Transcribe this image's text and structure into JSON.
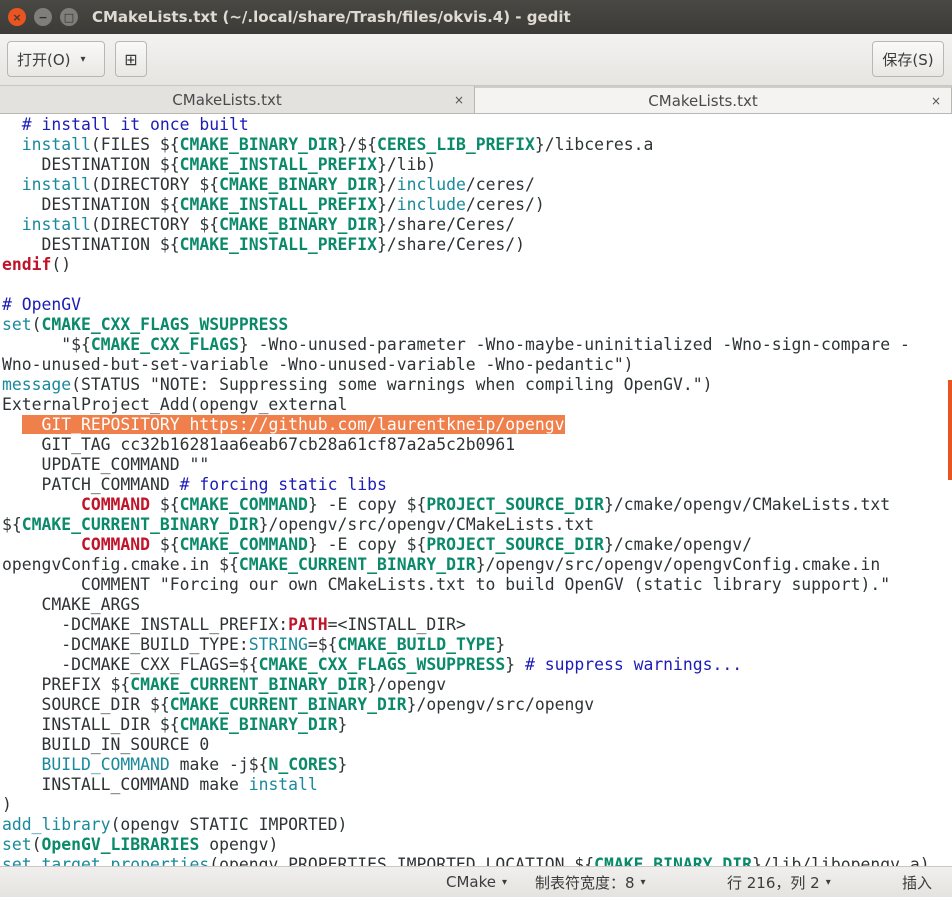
{
  "window": {
    "title": "CMakeLists.txt (~/.local/share/Trash/files/okvis.4) - gedit",
    "close_glyph": "×",
    "min_glyph": "−",
    "max_glyph": "□"
  },
  "toolbar": {
    "open_label": "打开(O)",
    "open_arrow": "▾",
    "new_tab_glyph": "⊞",
    "save_label": "保存(S)"
  },
  "tabs": [
    {
      "label": "CMakeLists.txt",
      "close": "×",
      "active": false
    },
    {
      "label": "CMakeLists.txt",
      "close": "×",
      "active": true
    }
  ],
  "editor": {
    "lines": [
      [
        [
          "  ",
          ""
        ],
        [
          "# install it once built",
          "c"
        ]
      ],
      [
        [
          "  ",
          ""
        ],
        [
          "install",
          "k"
        ],
        [
          "(FILES ${",
          ""
        ],
        [
          "CMAKE_BINARY_DIR",
          "v"
        ],
        [
          "}/${",
          ""
        ],
        [
          "CERES_LIB_PREFIX",
          "v"
        ],
        [
          "}/libceres.a",
          ""
        ]
      ],
      [
        [
          "    DESTINATION ${",
          ""
        ],
        [
          "CMAKE_INSTALL_PREFIX",
          "v"
        ],
        [
          "}/lib)",
          ""
        ]
      ],
      [
        [
          "  ",
          ""
        ],
        [
          "install",
          "k"
        ],
        [
          "(DIRECTORY ${",
          ""
        ],
        [
          "CMAKE_BINARY_DIR",
          "v"
        ],
        [
          "}/",
          ""
        ],
        [
          "include",
          "k"
        ],
        [
          "/ceres/",
          ""
        ]
      ],
      [
        [
          "    DESTINATION ${",
          ""
        ],
        [
          "CMAKE_INSTALL_PREFIX",
          "v"
        ],
        [
          "}/",
          ""
        ],
        [
          "include",
          "k"
        ],
        [
          "/ceres/)",
          ""
        ]
      ],
      [
        [
          "  ",
          ""
        ],
        [
          "install",
          "k"
        ],
        [
          "(DIRECTORY ${",
          ""
        ],
        [
          "CMAKE_BINARY_DIR",
          "v"
        ],
        [
          "}/share/Ceres/",
          ""
        ]
      ],
      [
        [
          "    DESTINATION ${",
          ""
        ],
        [
          "CMAKE_INSTALL_PREFIX",
          "v"
        ],
        [
          "}/share/Ceres/)",
          ""
        ]
      ],
      [
        [
          "endif",
          "r"
        ],
        [
          "()",
          ""
        ]
      ],
      [
        [
          "",
          ""
        ]
      ],
      [
        [
          "# OpenGV",
          "c"
        ]
      ],
      [
        [
          "set",
          "k"
        ],
        [
          "(",
          ""
        ],
        [
          "CMAKE_CXX_FLAGS_WSUPPRESS",
          "v"
        ]
      ],
      [
        [
          "      \"${",
          ""
        ],
        [
          "CMAKE_CXX_FLAGS",
          "v"
        ],
        [
          "} -Wno-unused-parameter -Wno-maybe-uninitialized -Wno-sign-compare -",
          ""
        ]
      ],
      [
        [
          "Wno-unused-but-set-variable -Wno-unused-variable -Wno-pedantic\")",
          ""
        ]
      ],
      [
        [
          "message",
          "k"
        ],
        [
          "(STATUS \"NOTE: Suppressing some warnings when compiling OpenGV.\")",
          ""
        ]
      ],
      [
        [
          "ExternalProject_Add(opengv_external",
          ""
        ]
      ],
      [
        [
          "  ",
          ""
        ],
        [
          "  GIT_REPOSITORY https://github.com/laurentkneip/opengv",
          "hl"
        ]
      ],
      [
        [
          "    GIT_TAG cc32b16281aa6eab67cb28a61cf87a2a5c2b0961",
          ""
        ]
      ],
      [
        [
          "    UPDATE_COMMAND \"\"",
          ""
        ]
      ],
      [
        [
          "    PATCH_COMMAND ",
          ""
        ],
        [
          "# forcing static libs",
          "c"
        ]
      ],
      [
        [
          "        ",
          ""
        ],
        [
          "COMMAND",
          "r"
        ],
        [
          " ${",
          ""
        ],
        [
          "CMAKE_COMMAND",
          "v"
        ],
        [
          "} -E copy ${",
          ""
        ],
        [
          "PROJECT_SOURCE_DIR",
          "v"
        ],
        [
          "}/cmake/opengv/CMakeLists.txt",
          ""
        ]
      ],
      [
        [
          "${",
          ""
        ],
        [
          "CMAKE_CURRENT_BINARY_DIR",
          "v"
        ],
        [
          "}/opengv/src/opengv/CMakeLists.txt",
          ""
        ]
      ],
      [
        [
          "        ",
          ""
        ],
        [
          "COMMAND",
          "r"
        ],
        [
          " ${",
          ""
        ],
        [
          "CMAKE_COMMAND",
          "v"
        ],
        [
          "} -E copy ${",
          ""
        ],
        [
          "PROJECT_SOURCE_DIR",
          "v"
        ],
        [
          "}/cmake/opengv/",
          ""
        ]
      ],
      [
        [
          "opengvConfig.cmake.in ${",
          ""
        ],
        [
          "CMAKE_CURRENT_BINARY_DIR",
          "v"
        ],
        [
          "}/opengv/src/opengv/opengvConfig.cmake.in",
          ""
        ]
      ],
      [
        [
          "        COMMENT \"Forcing our own CMakeLists.txt to build OpenGV (static library support).\"",
          ""
        ]
      ],
      [
        [
          "    CMAKE_ARGS",
          ""
        ]
      ],
      [
        [
          "      -DCMAKE_INSTALL_PREFIX:",
          ""
        ],
        [
          "PATH",
          "r"
        ],
        [
          "=<INSTALL_DIR>",
          ""
        ]
      ],
      [
        [
          "      -DCMAKE_BUILD_TYPE:",
          ""
        ],
        [
          "STRING",
          "k"
        ],
        [
          "=${",
          ""
        ],
        [
          "CMAKE_BUILD_TYPE",
          "v"
        ],
        [
          "}",
          ""
        ]
      ],
      [
        [
          "      -DCMAKE_CXX_FLAGS=${",
          ""
        ],
        [
          "CMAKE_CXX_FLAGS_WSUPPRESS",
          "v"
        ],
        [
          "} ",
          ""
        ],
        [
          "# suppress warnings...",
          "c"
        ]
      ],
      [
        [
          "    PREFIX ${",
          ""
        ],
        [
          "CMAKE_CURRENT_BINARY_DIR",
          "v"
        ],
        [
          "}/opengv",
          ""
        ]
      ],
      [
        [
          "    SOURCE_DIR ${",
          ""
        ],
        [
          "CMAKE_CURRENT_BINARY_DIR",
          "v"
        ],
        [
          "}/opengv/src/opengv",
          ""
        ]
      ],
      [
        [
          "    INSTALL_DIR ${",
          ""
        ],
        [
          "CMAKE_BINARY_DIR",
          "v"
        ],
        [
          "}",
          ""
        ]
      ],
      [
        [
          "    BUILD_IN_SOURCE 0",
          ""
        ]
      ],
      [
        [
          "    ",
          ""
        ],
        [
          "BUILD_COMMAND",
          "k"
        ],
        [
          " make -j${",
          ""
        ],
        [
          "N_CORES",
          "v"
        ],
        [
          "}",
          ""
        ]
      ],
      [
        [
          "    INSTALL_COMMAND make ",
          ""
        ],
        [
          "install",
          "k"
        ]
      ],
      [
        [
          ")",
          ""
        ]
      ],
      [
        [
          "add_library",
          "k"
        ],
        [
          "(opengv STATIC IMPORTED)",
          ""
        ]
      ],
      [
        [
          "set",
          "k"
        ],
        [
          "(",
          ""
        ],
        [
          "OpenGV_LIBRARIES",
          "v"
        ],
        [
          " opengv)",
          ""
        ]
      ],
      [
        [
          "set_target_properties",
          "k"
        ],
        [
          "(opengv PROPERTIES IMPORTED_LOCATION ${",
          ""
        ],
        [
          "CMAKE_BINARY_DIR",
          "v"
        ],
        [
          "}/lib/libopengv.a)",
          ""
        ]
      ]
    ]
  },
  "statusbar": {
    "language": "CMake",
    "tab_width": "制表符宽度：8",
    "position": "行 216，列 2",
    "mode": "插入",
    "dropdown_glyph": "▾"
  },
  "colors": {
    "accent": "#e95420",
    "comment": "#1c1cb8",
    "keyword": "#198a9c",
    "variable": "#0a8a6a",
    "red_keyword": "#c0142a",
    "highlight": "#ef7f4b"
  }
}
